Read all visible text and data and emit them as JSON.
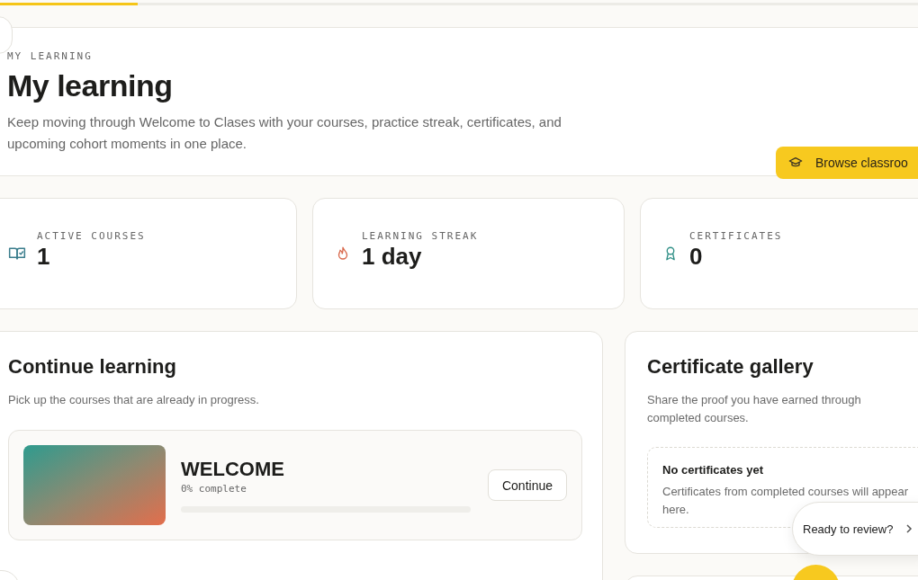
{
  "top_progress": {
    "level": 0.15
  },
  "hero": {
    "eyebrow": "MY LEARNING",
    "title": "My learning",
    "description": "Keep moving through Welcome to Clases with your courses, practice streak, certificates, and upcoming cohort moments in one place.",
    "button": "Browse classroo"
  },
  "stats": [
    {
      "kind": "courses",
      "label": "ACTIVE COURSES",
      "value": "1"
    },
    {
      "kind": "streak",
      "label": "LEARNING STREAK",
      "value": "1 day"
    },
    {
      "kind": "certificates",
      "label": "CERTIFICATES",
      "value": "0"
    }
  ],
  "continue_learning": {
    "title": "Continue learning",
    "subtitle": "Pick up the courses that are already in progress.",
    "courses": [
      {
        "title": "WELCOME",
        "progress_text": "0% complete",
        "button": "Continue"
      }
    ]
  },
  "certificate_gallery": {
    "title": "Certificate gallery",
    "subtitle": "Share the proof you have earned through completed courses.",
    "empty_title": "No certificates yet",
    "empty_text": "Certificates from completed courses will appear here."
  },
  "review_prompt": {
    "text": "Ready to review?"
  }
}
